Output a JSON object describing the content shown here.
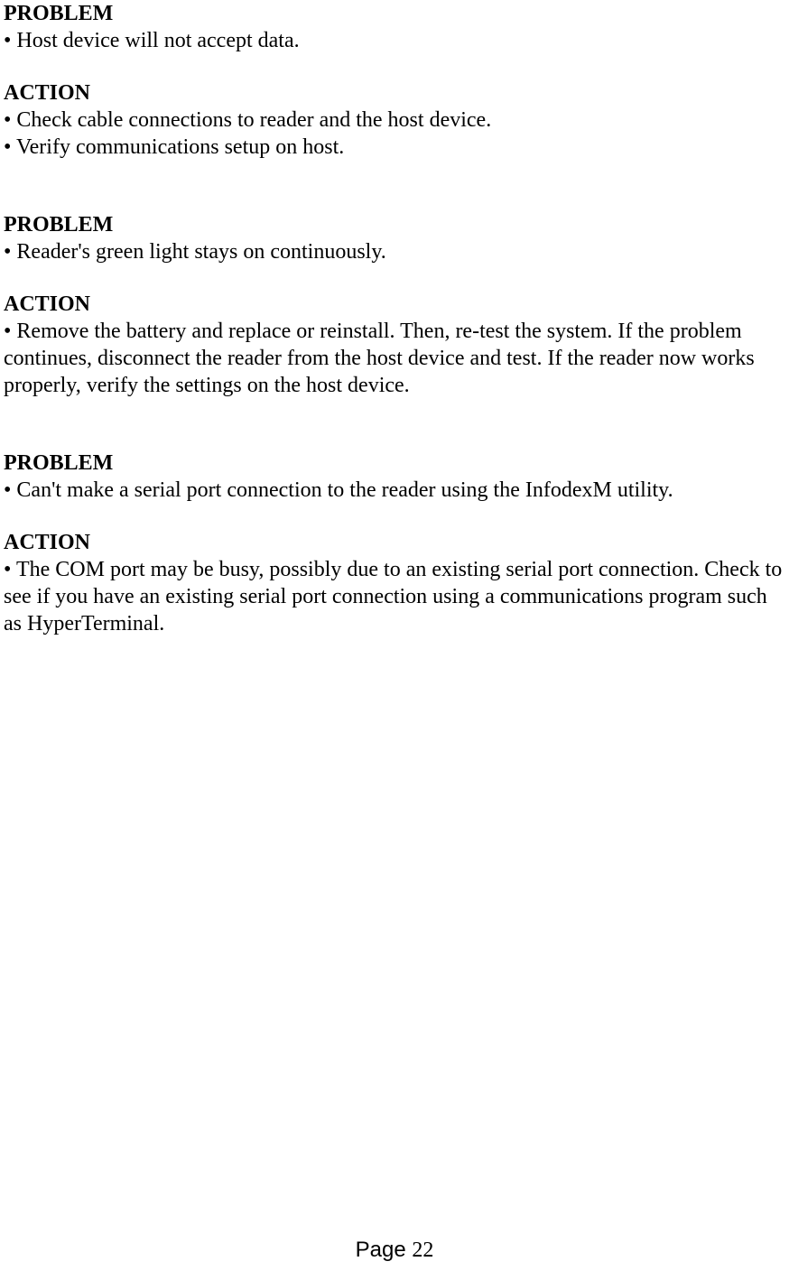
{
  "sections": [
    {
      "problemHeading": "PROBLEM",
      "problemItems": [
        "• Host device will not accept data."
      ],
      "actionHeading": "ACTION",
      "actionItems": [
        "• Check cable connections to reader and the host device.",
        "• Verify communications setup on host."
      ]
    },
    {
      "problemHeading": "PROBLEM",
      "problemItems": [
        "• Reader's green light stays on continuously."
      ],
      "actionHeading": "ACTION",
      "actionItems": [
        "• Remove the battery and replace or reinstall. Then, re-test the system. If the problem continues, disconnect the reader from the host device and test. If the reader now works properly, verify the settings on the host device."
      ]
    },
    {
      "problemHeading": "PROBLEM",
      "problemItems": [
        "• Can't make a serial port connection to the reader using the InfodexM utility."
      ],
      "actionHeading": "ACTION",
      "actionItems": [
        "• The COM port may be busy, possibly due to an existing serial port connection. Check to see if you have an existing serial port connection using a communications program such as HyperTerminal."
      ]
    }
  ],
  "footer": {
    "pageLabel": "Page ",
    "pageNumber": "22"
  }
}
